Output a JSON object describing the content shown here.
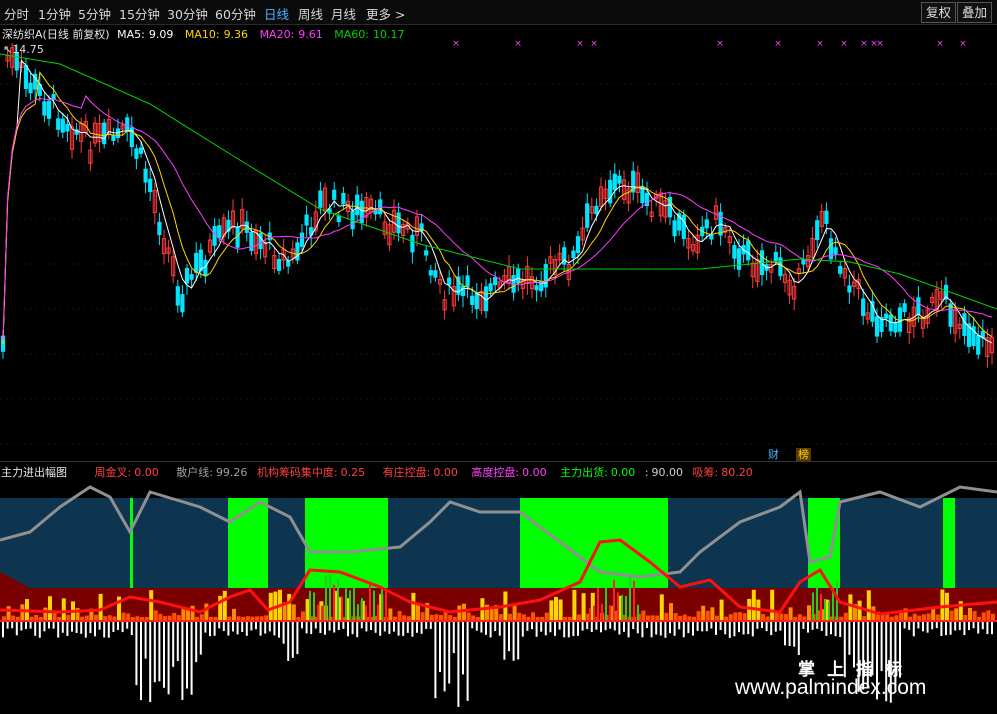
{
  "toolbar": {
    "periods": [
      "分时",
      "1分钟",
      "5分钟",
      "15分钟",
      "30分钟",
      "60分钟",
      "日线",
      "周线",
      "月线",
      "更多 >"
    ],
    "active": "日线",
    "fuquan_label": "复权",
    "overlay_label": "叠加"
  },
  "main_legend": {
    "stock_title": "深纺织A(日线 前复权)",
    "ma5_label": "MA5:",
    "ma5_value": "9.09",
    "ma10_label": "MA10:",
    "ma10_value": "9.36",
    "ma20_label": "MA20:",
    "ma20_value": "9.61",
    "ma60_label": "MA60:",
    "ma60_value": "10.17",
    "max_price": "14.75"
  },
  "colors": {
    "up": "#ff3c3c",
    "down": "#00e5ff",
    "ma5": "#ffffff",
    "ma10": "#ffd400",
    "ma20": "#ff3cff",
    "ma60": "#00d400",
    "zone_blue": "#0e3550",
    "zone_green": "#00ff00",
    "band": "#7a0000",
    "gray_line": "#909090",
    "red_line": "#ff1010"
  },
  "markers": {
    "event_icon": "x-mark-icon",
    "finance_tag": "财",
    "rank_tag": "榜"
  },
  "indicator_legend": {
    "name": "主力进出幅图",
    "items": [
      {
        "label": "周金叉:",
        "value": "0.00",
        "color": "#ff4040"
      },
      {
        "label": "散户线:",
        "value": "99.26",
        "color": "#a0a0a0"
      },
      {
        "label": "机构筹码集中度:",
        "value": "0.25",
        "color": "#ff4040"
      },
      {
        "label": "有庄控盘:",
        "value": "0.00",
        "color": "#ff4040"
      },
      {
        "label": "高度控盘:",
        "value": "0.00",
        "color": "#ff40ff"
      },
      {
        "label": "主力出货:",
        "value": "0.00",
        "color": "#00ff00"
      },
      {
        "label": ":",
        "value": "90.00",
        "color": "#d0d0d0"
      },
      {
        "label": "吸筹:",
        "value": "80.20",
        "color": "#ff4040"
      }
    ]
  },
  "watermark": {
    "cn": "掌上指标",
    "url": "www.palmindex.com"
  }
}
